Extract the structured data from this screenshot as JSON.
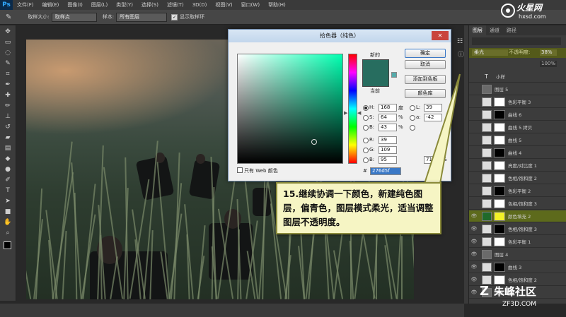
{
  "app": {
    "logo": "Ps"
  },
  "menu": [
    "文件(F)",
    "编辑(E)",
    "图像(I)",
    "图层(L)",
    "类型(Y)",
    "选择(S)",
    "滤镜(T)",
    "3D(D)",
    "视图(V)",
    "窗口(W)",
    "帮助(H)"
  ],
  "options": {
    "sample_size_label": "取样大小:",
    "sample_size_value": "取样点",
    "sample_label": "样本:",
    "sample_value": "所有图层",
    "show_ring_label": "显示取样环"
  },
  "tools": [
    "move-icon",
    "marquee-icon",
    "lasso-icon",
    "quick-select-icon",
    "crop-icon",
    "eyedropper-icon",
    "healing-icon",
    "brush-icon",
    "stamp-icon",
    "history-brush-icon",
    "eraser-icon",
    "gradient-icon",
    "blur-icon",
    "dodge-icon",
    "pen-icon",
    "type-icon",
    "path-select-icon",
    "shape-icon",
    "hand-icon",
    "zoom-icon"
  ],
  "picker": {
    "title": "拾色器（纯色）",
    "new_label": "新的",
    "current_label": "当前",
    "ok": "确定",
    "cancel": "取消",
    "add_swatch": "添加到色板",
    "color_library": "颜色库",
    "h_label": "H:",
    "h_value": "168",
    "h_unit": "度",
    "s_label": "S:",
    "s_value": "64",
    "s_unit": "%",
    "b_label": "B:",
    "b_value": "43",
    "b_unit": "%",
    "r_label": "R:",
    "r_value": "39",
    "g_label": "G:",
    "g_value": "109",
    "blue_label": "B:",
    "blue_value": "95",
    "l_label": "L:",
    "l_value": "39",
    "a_label": "a:",
    "a_value": "-42",
    "pct_71": "71",
    "pct_unit": "%",
    "hex_label": "#",
    "hex_value": "276d5f",
    "web_only": "只有 Web 颜色",
    "new_color": "#276d5f"
  },
  "callout": {
    "text": "15.继续协调一下颜色，新建纯色图层，偏青色，图层模式柔光，适当调整图层不透明度。"
  },
  "layers_panel": {
    "tabs": [
      "图层",
      "通道",
      "路径"
    ],
    "blend_mode": "柔光",
    "opacity_label": "不透明度:",
    "opacity_value": "38%",
    "fill_value": "100%",
    "layers": [
      {
        "name": "小样",
        "type": "text",
        "visible": false
      },
      {
        "name": "图层 5",
        "type": "pixel",
        "visible": false
      },
      {
        "name": "色彩平衡 3",
        "type": "adj",
        "visible": false
      },
      {
        "name": "曲线 6",
        "type": "adj",
        "visible": false
      },
      {
        "name": "曲线 5 拷贝",
        "type": "adj",
        "visible": false
      },
      {
        "name": "曲线 5",
        "type": "adj",
        "visible": false
      },
      {
        "name": "曲线 4",
        "type": "adj",
        "visible": false
      },
      {
        "name": "亮度/对比度 1",
        "type": "adj",
        "visible": false
      },
      {
        "name": "色相/饱和度 2",
        "type": "adj",
        "visible": false
      },
      {
        "name": "色彩平衡 2",
        "type": "adj",
        "visible": false
      },
      {
        "name": "色相/饱和度 3",
        "type": "adj",
        "visible": false
      },
      {
        "name": "颜色填充 2",
        "type": "fill",
        "visible": true,
        "selected": true
      },
      {
        "name": "色相/饱和度 3",
        "type": "adj",
        "visible": true
      },
      {
        "name": "色彩平衡 1",
        "type": "adj",
        "visible": true
      },
      {
        "name": "图层 4",
        "type": "pixel",
        "visible": true
      },
      {
        "name": "曲线 3",
        "type": "adj",
        "visible": true
      },
      {
        "name": "色相/饱和度 2",
        "type": "adj",
        "visible": true
      },
      {
        "name": "图层 3",
        "type": "pixel",
        "visible": true
      }
    ]
  },
  "watermarks": {
    "top_brand": "火星网",
    "top_url": "hxsd.com",
    "bottom_brand": "朱峰社区",
    "bottom_url": "ZF3D.COM"
  }
}
